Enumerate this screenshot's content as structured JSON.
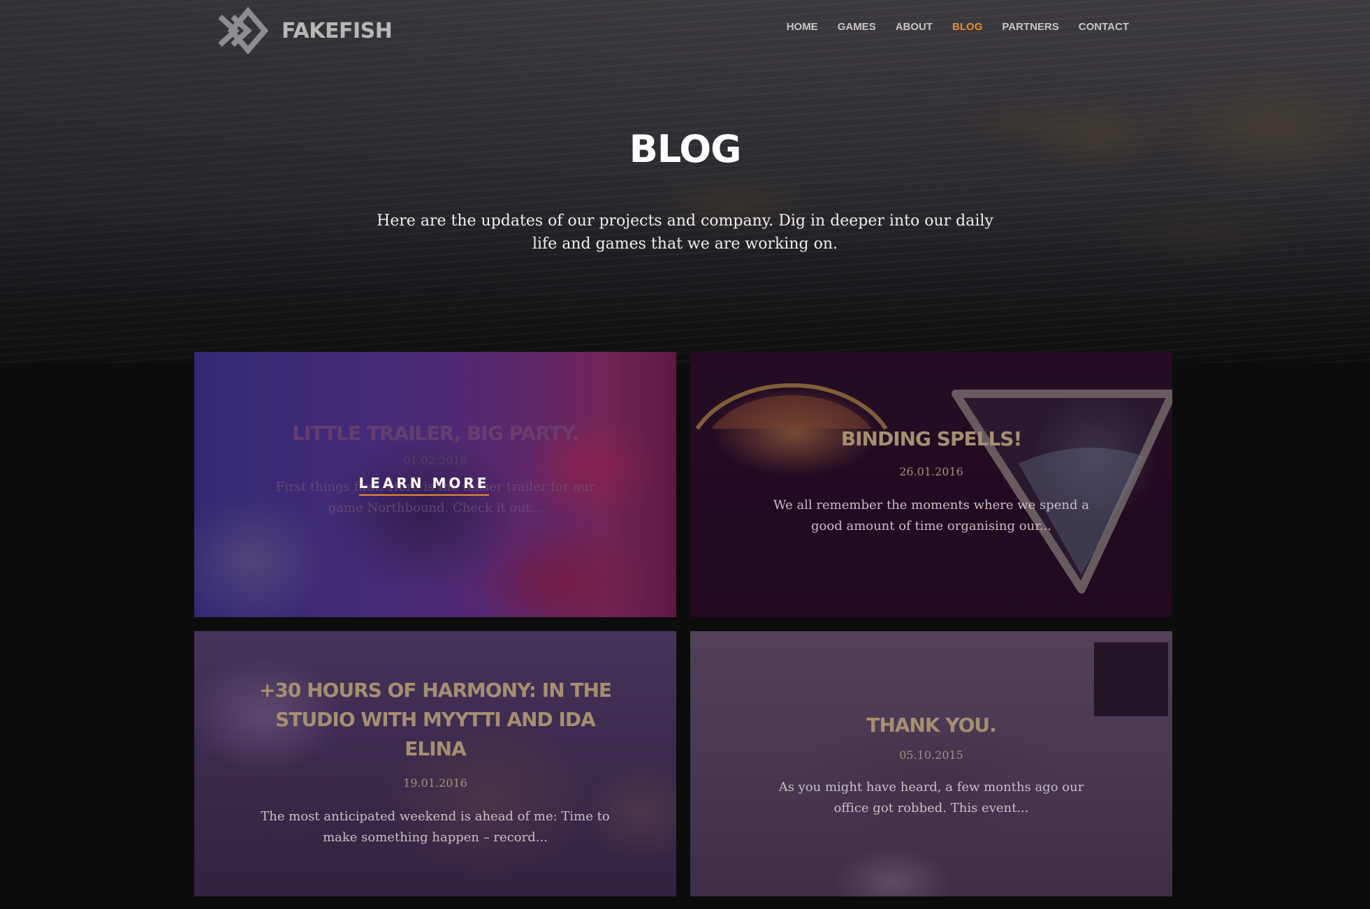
{
  "brand": {
    "name": "FAKEFISH"
  },
  "nav": {
    "items": [
      {
        "label": "HOME",
        "active": false
      },
      {
        "label": "GAMES",
        "active": false
      },
      {
        "label": "ABOUT",
        "active": false
      },
      {
        "label": "BLOG",
        "active": true
      },
      {
        "label": "PARTNERS",
        "active": false
      },
      {
        "label": "CONTACT",
        "active": false
      }
    ]
  },
  "hero": {
    "title": "BLOG",
    "subtitle": "Here are the updates of our projects and company. Dig in deeper into our daily life and games that we are working on."
  },
  "posts": [
    {
      "title": "LITTLE TRAILER, BIG PARTY.",
      "date": "01.02.2016",
      "excerpt": "First things first. Here is the teaser trailer for our game Northbound. Check it out...",
      "hover_cta": "LEARN MORE"
    },
    {
      "title": "BINDING SPELLS!",
      "date": "26.01.2016",
      "excerpt": "We all remember the moments where we spend a good amount of time organising our..."
    },
    {
      "title": "+30 HOURS OF HARMONY: IN THE STUDIO WITH MYYTTI AND IDA ELINA",
      "date": "19.01.2016",
      "excerpt": "The most anticipated weekend is ahead of me: Time to make something happen – record..."
    },
    {
      "title": "THANK YOU.",
      "date": "05.10.2015",
      "excerpt": "As you might have heard, a few months ago our office got robbed. This event..."
    }
  ],
  "colors": {
    "accent": "#e98d2c",
    "card_title": "#a58f71",
    "page_background": "#0c0c0c"
  }
}
